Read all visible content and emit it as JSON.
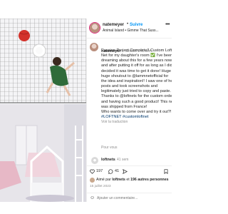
{
  "post_header": {
    "username": "natemeyer",
    "separator": "•",
    "follow_label": "Suivre",
    "audio": "Animal Island • Gimme That Suss...",
    "more_icon": "more-horizontal-icon"
  },
  "caption": {
    "username": "natemeyer",
    "edited": "Modifié · 41 sem",
    "lines": [
      "Passion Project Complete!! Custom Loft",
      "Net for my daughter's room ✅ I've been",
      "dreaming about this for a few years now",
      "and after putting it off for as long as I did",
      "decided it was time to get it done! Huge",
      "huge shoutout to @lammnetofficial for",
      "the idea and inspiration!! I saw one of her",
      "posts and took screenshots and",
      "legitimately just tried to copy and paste.",
      "Thanks to @loftnets for the custom order",
      "and having such a good product! This net",
      "was shipped from France!",
      "Who wants to come over and try it out?!",
      "#LOFTNET #customloftnet"
    ],
    "see_translation": "Voir la traduction",
    "see_more": "Pour vous"
  },
  "reply": {
    "username": "loftnets",
    "time": "41 sem"
  },
  "actions": {
    "likes_count": "197",
    "comments_count": "41",
    "heart_icon": "heart-icon",
    "comment_icon": "comment-icon",
    "share_icon": "share-icon",
    "save_icon": "bookmark-icon"
  },
  "likes": {
    "prefix": "Aimé par ",
    "user": "loftnets",
    "middle": " et ",
    "others": "196 autres personnes"
  },
  "date": "15 juillet 2023",
  "comment_box": {
    "placeholder": "Ajouter un commentaire..."
  },
  "colors": {
    "accent": "#0095f6",
    "link": "#00376b",
    "muted": "#8e8e8e"
  }
}
